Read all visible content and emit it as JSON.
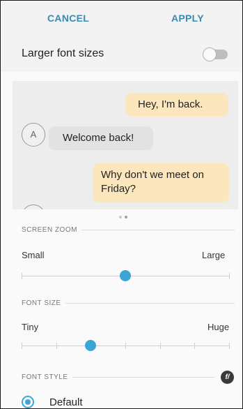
{
  "action_bar": {
    "cancel_label": "CANCEL",
    "apply_label": "APPLY"
  },
  "larger_font": {
    "label": "Larger font sizes",
    "enabled": false
  },
  "preview": {
    "avatar_letter": "A",
    "messages": [
      {
        "type": "sent",
        "text": "Hey, I'm back."
      },
      {
        "type": "received",
        "text": "Welcome back!"
      },
      {
        "type": "sent",
        "text": "Why don't we meet on Friday?"
      }
    ],
    "page_count": 2,
    "active_page": 2
  },
  "screen_zoom": {
    "header": "SCREEN ZOOM",
    "min_label": "Small",
    "max_label": "Large",
    "value": 0.5
  },
  "font_size": {
    "header": "FONT SIZE",
    "min_label": "Tiny",
    "max_label": "Huge",
    "steps": 7,
    "selected_step": 2
  },
  "font_style": {
    "header": "FONT STYLE",
    "icon_glyph": "f/",
    "options": [
      {
        "label": "Default",
        "selected": true
      }
    ]
  },
  "colors": {
    "accent": "#3aa5d6",
    "action_text": "#3b8ab0",
    "sent_bubble": "#fbe6be",
    "received_bubble": "#e2e2e2"
  }
}
